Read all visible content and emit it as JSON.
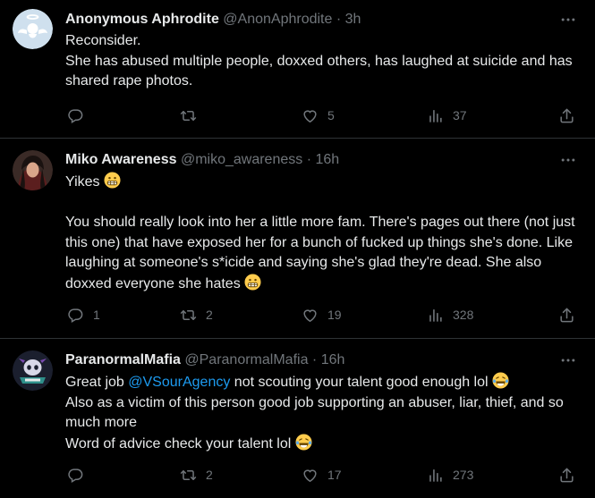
{
  "colors": {
    "background": "#000000",
    "text": "#e7e9ea",
    "muted": "#71767b",
    "divider": "#2f3336",
    "link": "#1d9bf0"
  },
  "icons": [
    "more-icon",
    "reply-icon",
    "retweet-icon",
    "like-icon",
    "views-icon",
    "share-icon",
    "grimace-emoji",
    "laugh-cry-emoji"
  ],
  "tweets": [
    {
      "name": "Anonymous Aphrodite",
      "handle": "@AnonAphrodite",
      "dot": "·",
      "time": "3h",
      "lines": [
        "Reconsider.",
        "She has abused multiple people, doxxed others, has laughed at suicide and has shared rape photos."
      ],
      "replies": "",
      "retweets": "",
      "likes": "5",
      "views": "37"
    },
    {
      "name": "Miko Awareness",
      "handle": "@miko_awareness",
      "dot": "·",
      "time": "16h",
      "line1": "Yikes",
      "para": "You should really look into her a little more fam. There's pages out there (not just this one) that have exposed her for a bunch of fucked up things she's done. Like laughing at someone's s*icide and saying she's glad they're dead. She also doxxed everyone she hates",
      "replies": "1",
      "retweets": "2",
      "likes": "19",
      "views": "328"
    },
    {
      "name": "ParanormalMafia",
      "handle": "@ParanormalMafia",
      "dot": "·",
      "time": "16h",
      "line1_pre": "Great job",
      "mention": "@VSourAgency",
      "line1_post": "not scouting your talent good enough lol",
      "line2": "Also as a victim of this person good job supporting an abuser, liar, thief, and so much more",
      "line3": "Word of advice check your talent lol",
      "replies": "",
      "retweets": "2",
      "likes": "17",
      "views": "273"
    }
  ]
}
